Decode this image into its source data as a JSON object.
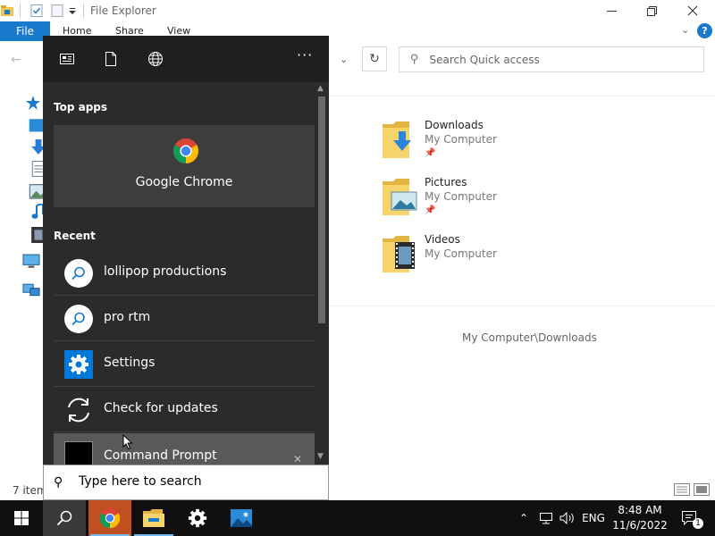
{
  "explorer": {
    "title": "File Explorer",
    "ribbon_tabs": {
      "file": "File",
      "home": "Home",
      "share": "Share",
      "view": "View"
    },
    "search_placeholder": "Search Quick access",
    "quick_access": [
      {
        "name": "Downloads",
        "location": "My Computer",
        "icon": "downloads-folder-icon"
      },
      {
        "name": "Pictures",
        "location": "My Computer",
        "icon": "pictures-folder-icon"
      },
      {
        "name": "Videos",
        "location": "My Computer",
        "icon": "videos-folder-icon"
      }
    ],
    "details_path": "My Computer\\Downloads",
    "status": {
      "item_count": "7 item"
    }
  },
  "flyout": {
    "top_apps_heading": "Top apps",
    "top_app": {
      "label": "Google Chrome",
      "icon": "chrome-icon"
    },
    "recent_heading": "Recent",
    "recent": [
      {
        "label": "lollipop productions",
        "icon": "search-icon"
      },
      {
        "label": "pro rtm",
        "icon": "search-icon"
      },
      {
        "label": "Settings",
        "icon": "gear-icon"
      },
      {
        "label": "Check for updates",
        "icon": "sync-icon"
      },
      {
        "label": "Command Prompt",
        "icon": "cmd-icon"
      }
    ],
    "more_label": "···",
    "search_placeholder": "Type here to search"
  },
  "taskbar": {
    "language": "ENG",
    "time": "8:48 AM",
    "date": "11/6/2022",
    "notification_count": "1"
  },
  "colors": {
    "accent": "#0078d7",
    "ribbon_file": "#1979ca",
    "flyout_bg": "#2b2b2b",
    "taskbar_bg": "#101010"
  }
}
